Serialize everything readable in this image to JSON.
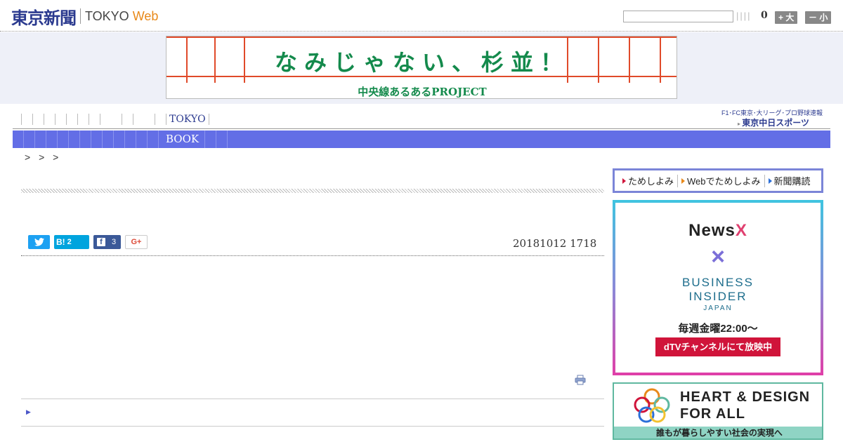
{
  "header": {
    "logo_jp": "東京新聞",
    "logo_tokyo": "TOKYO",
    "logo_web": "Web",
    "bars": "||||",
    "count": "0",
    "size_up": "+ 大",
    "size_down": "－ 小"
  },
  "banner": {
    "title": "なみじゃない、杉並！",
    "subtitle": "中央線あるあるPROJECT"
  },
  "nav": {
    "tokyo": "TOKYO",
    "book": "BOOK",
    "right_line1": "F1･FC東京･大リーグ･プロ野球速報",
    "right_line2": "東京中日スポーツ"
  },
  "breadcrumb": "> > >",
  "article": {
    "hatena_count": "2",
    "facebook_count": "3",
    "googleplus": "G+",
    "date": "20181012 1718"
  },
  "sidebar": {
    "subscribe": {
      "item1": "ためしよみ",
      "item2": "Webでためしよみ",
      "item3": "新聞購読"
    },
    "ad1": {
      "newsx": "News",
      "newsx_x": "X",
      "cross": "×",
      "bi_line1": "BUSINESS",
      "bi_line2": "INSIDER",
      "bi_line3": "JAPAN",
      "weekly": "毎週金曜22:00〜",
      "dtv": "dTVチャンネルにて放映中"
    },
    "ad2": {
      "line1": "HEART & DESIGN",
      "line2": "FOR ALL",
      "tagline": "誰もが暮らしやすい社会の実現へ"
    }
  },
  "colors": {
    "nav_bar": "#636ee6",
    "brand_blue": "#2b3a8f",
    "web_orange": "#e8891a",
    "banner_green": "#148a4c",
    "banner_red": "#e04a2a"
  }
}
